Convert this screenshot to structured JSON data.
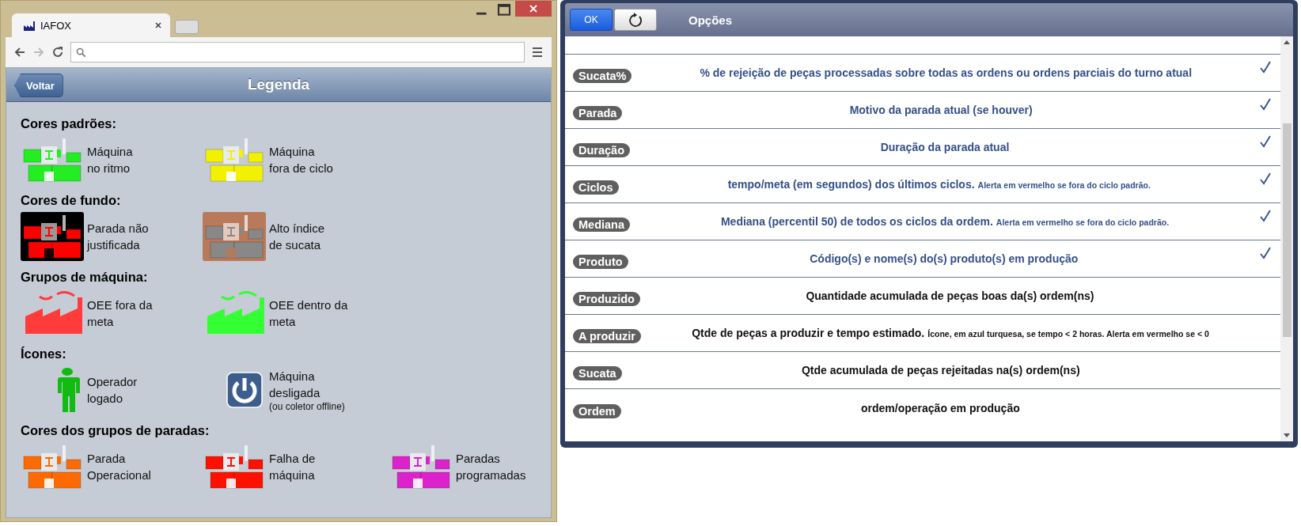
{
  "browser": {
    "tab_title": "IAFOX"
  },
  "legend_page": {
    "back_button": "Voltar",
    "title": "Legenda",
    "sections": [
      {
        "title": "Cores padrões:",
        "items": [
          {
            "kind": "machine",
            "color": "#22ee22",
            "label_lines": [
              "Máquina",
              "no ritmo"
            ]
          },
          {
            "kind": "machine",
            "color": "#f2f200",
            "label_lines": [
              "Máquina",
              "fora de ciclo"
            ]
          }
        ]
      },
      {
        "title": "Cores de fundo:",
        "items": [
          {
            "kind": "machine_bg",
            "color": "#ff0000",
            "tile": {
              "color": "#000000"
            },
            "label_lines": [
              "Parada não",
              "justificada"
            ]
          },
          {
            "kind": "machine_bg",
            "color": "#888888",
            "tile": {
              "color": "#b87a5a"
            },
            "label_lines": [
              "Alto índice",
              "de sucata"
            ]
          }
        ]
      },
      {
        "title": "Grupos de máquina:",
        "items": [
          {
            "kind": "factory",
            "color": "#ff3b3b",
            "label_lines": [
              "OEE fora da",
              "meta"
            ]
          },
          {
            "kind": "factory",
            "color": "#33ff33",
            "label_lines": [
              "OEE dentro da",
              "meta"
            ]
          }
        ]
      },
      {
        "title": "Ícones:",
        "items": [
          {
            "kind": "operator",
            "color": "#11bb11",
            "label_lines": [
              "Operador",
              "logado"
            ]
          },
          {
            "kind": "power",
            "color": "#3d5e8c",
            "label_lines": [
              "Máquina",
              "desligada"
            ],
            "note": "(ou coletor offline)"
          }
        ]
      },
      {
        "title": "Cores dos grupos de paradas:",
        "items": [
          {
            "kind": "machine",
            "color": "#ff6a00",
            "label_lines": [
              "Parada",
              "Operacional"
            ]
          },
          {
            "kind": "machine",
            "color": "#ff1100",
            "label_lines": [
              "Falha de",
              "máquina"
            ]
          },
          {
            "kind": "machine",
            "color": "#dd22cc",
            "label_lines": [
              "Paradas",
              "programadas"
            ]
          }
        ]
      }
    ]
  },
  "options_dialog": {
    "ok_button": "OK",
    "title": "Opções",
    "rows": [
      {
        "tag": "Sucata%",
        "text": "% de rejeição de peças processadas sobre todas as ordens ou ordens parciais do turno atual",
        "checked": true
      },
      {
        "tag": "Parada",
        "text": "Motivo da parada atual (se houver)",
        "checked": true
      },
      {
        "tag": "Duração",
        "text": "Duração da parada atual",
        "checked": true
      },
      {
        "tag": "Ciclos",
        "text": "tempo/meta (em segundos) dos últimos ciclos.",
        "note": "Alerta em vermelho se fora do ciclo padrão.",
        "checked": true
      },
      {
        "tag": "Mediana",
        "text": "Mediana (percentil 50) de todos os ciclos da ordem.",
        "note": "Alerta em vermelho se fora do ciclo padrão.",
        "checked": true
      },
      {
        "tag": "Produto",
        "text": "Código(s) e nome(s) do(s) produto(s) em produção",
        "checked": true
      },
      {
        "tag": "Produzido",
        "text": "Quantidade acumulada de peças boas da(s) ordem(ns)",
        "checked": false
      },
      {
        "tag": "A produzir",
        "text": "Qtde de peças a produzir e tempo estimado.",
        "note": "Ícone, em azul turquesa, se tempo < 2 horas. Alerta em vermelho se < 0",
        "checked": false
      },
      {
        "tag": "Sucata",
        "text": "Qtde acumulada de peças rejeitadas na(s) ordem(ns)",
        "checked": false
      },
      {
        "tag": "Ordem",
        "text": "ordem/operação em produção",
        "checked": false
      }
    ]
  }
}
